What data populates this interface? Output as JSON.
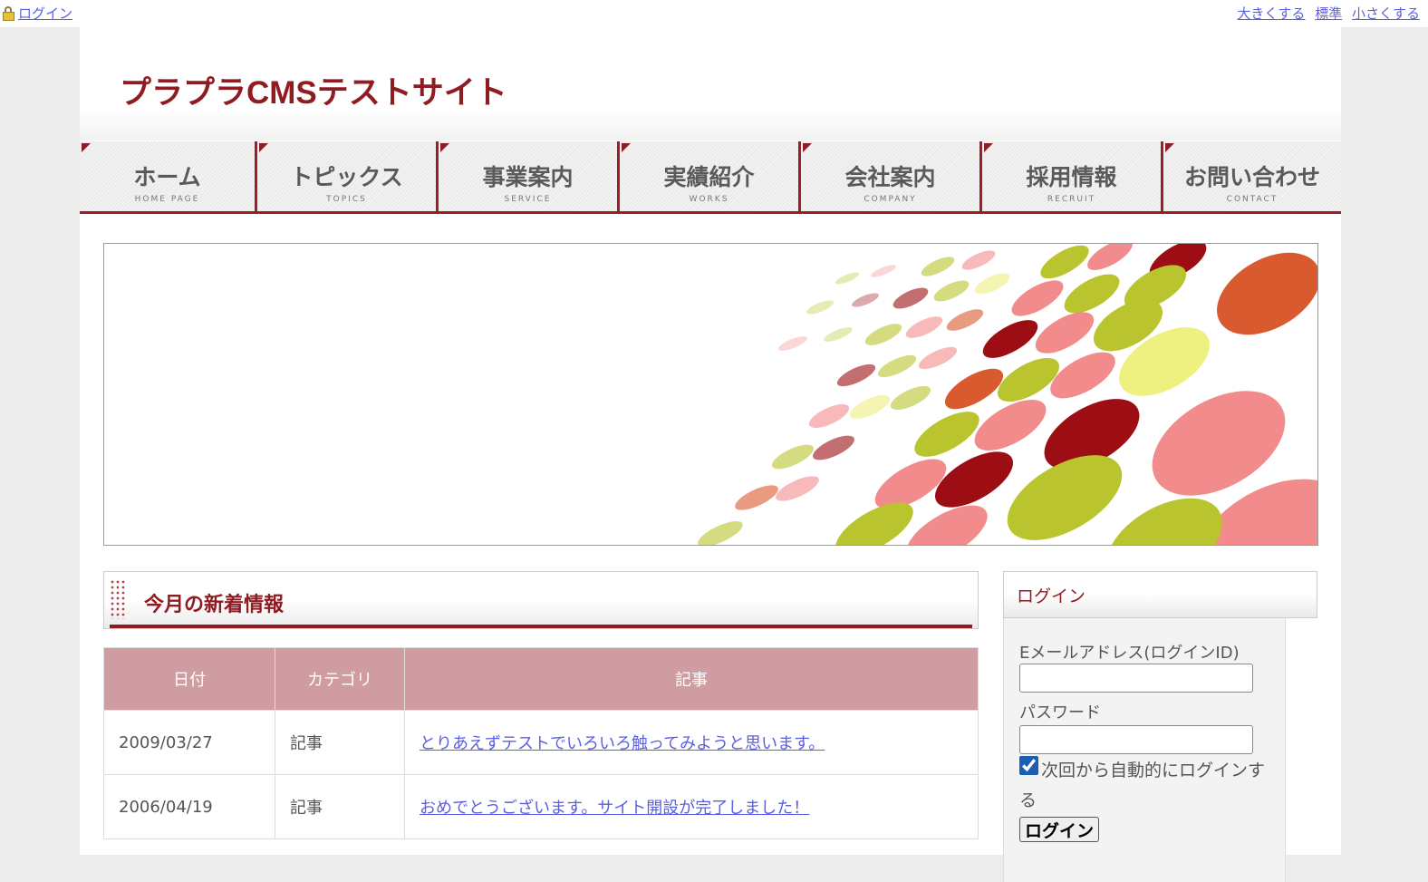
{
  "topbar": {
    "login_link": "ログイン",
    "font_size_links": [
      "大きくする",
      "標準",
      "小さくする"
    ]
  },
  "site": {
    "title": "プラプラCMSテストサイト"
  },
  "nav": {
    "items": [
      {
        "label": "ホーム",
        "sub": "HOME PAGE"
      },
      {
        "label": "トピックス",
        "sub": "TOPICS"
      },
      {
        "label": "事業案内",
        "sub": "SERVICE"
      },
      {
        "label": "実績紹介",
        "sub": "WORKS"
      },
      {
        "label": "会社案内",
        "sub": "COMPANY"
      },
      {
        "label": "採用情報",
        "sub": "RECRUIT"
      },
      {
        "label": "お問い合わせ",
        "sub": "CONTACT"
      }
    ]
  },
  "news": {
    "title": "今月の新着情報",
    "columns": [
      "日付",
      "カテゴリ",
      "記事"
    ],
    "rows": [
      {
        "date": "2009/03/27",
        "category": "記事",
        "article": "とりあえずテストでいろいろ触ってみようと思います。"
      },
      {
        "date": "2006/04/19",
        "category": "記事",
        "article": "おめでとうございます。サイト開設が完了しました！"
      }
    ]
  },
  "login": {
    "title": "ログイン",
    "email_label": "Eメールアドレス(ログインID)",
    "email_value": "",
    "password_label": "パスワード",
    "password_value": "",
    "auto_login_label": "次回から自動的にログインする",
    "auto_login_checked": true,
    "submit_label": "ログイン"
  },
  "colors": {
    "brand": "#8f1c23",
    "table_header": "#cf9ca1",
    "link": "#5a5fe0"
  }
}
